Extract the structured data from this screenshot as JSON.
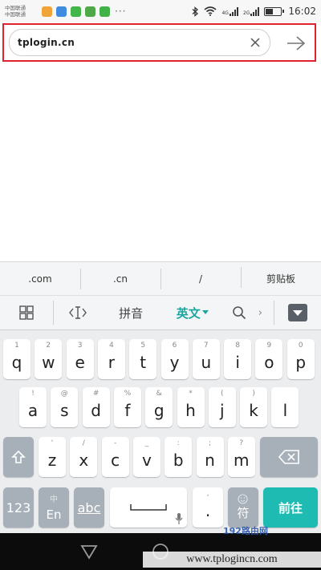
{
  "status_bar": {
    "carrier_lines": [
      "中国联通",
      "中国联通"
    ],
    "app_icon_colors": [
      "#f0a437",
      "#3f8be0",
      "#42b649",
      "#50a948",
      "#41b247"
    ],
    "more_indicator": "···",
    "signal_1": "4G",
    "signal_2": "2G",
    "battery_level": 0.5,
    "time": "16:02"
  },
  "address_bar": {
    "url": "tplogin.cn",
    "clear_icon": "close-icon",
    "go_icon": "arrow-right-icon",
    "highlight_color": "#e0212e"
  },
  "keyboard": {
    "suggestions": [
      ".com",
      ".cn",
      "/",
      "剪贴板"
    ],
    "toolbar": {
      "pinyin_label": "拼音",
      "english_label": "英文",
      "more_chevron": "›"
    },
    "rows": [
      [
        {
          "hint": "1",
          "key": "q"
        },
        {
          "hint": "2",
          "key": "w"
        },
        {
          "hint": "3",
          "key": "e"
        },
        {
          "hint": "4",
          "key": "r"
        },
        {
          "hint": "5",
          "key": "t"
        },
        {
          "hint": "6",
          "key": "y"
        },
        {
          "hint": "7",
          "key": "u"
        },
        {
          "hint": "8",
          "key": "i"
        },
        {
          "hint": "9",
          "key": "o"
        },
        {
          "hint": "0",
          "key": "p"
        }
      ],
      [
        {
          "hint": "!",
          "key": "a"
        },
        {
          "hint": "@",
          "key": "s"
        },
        {
          "hint": "#",
          "key": "d"
        },
        {
          "hint": "%",
          "key": "f"
        },
        {
          "hint": "&",
          "key": "g"
        },
        {
          "hint": "*",
          "key": "h"
        },
        {
          "hint": "(",
          "key": "j"
        },
        {
          "hint": ")",
          "key": "k"
        },
        {
          "hint": "",
          "key": "l"
        }
      ],
      [
        {
          "hint": "'",
          "key": "z"
        },
        {
          "hint": "/",
          "key": "x"
        },
        {
          "hint": "-",
          "key": "c"
        },
        {
          "hint": "_",
          "key": "v"
        },
        {
          "hint": ":",
          "key": "b"
        },
        {
          "hint": ";",
          "key": "n"
        },
        {
          "hint": "?",
          "key": "m"
        }
      ]
    ],
    "bottom": {
      "num_label": "123",
      "lang_top": "中",
      "lang_bottom": "En",
      "abc_label": "abc",
      "comma": ",",
      "period": ".",
      "symbol_label": "符",
      "go_label": "前往"
    },
    "accent_color": "#1ebbb2"
  },
  "watermark": {
    "logo_text": "192路由网",
    "url": "www.tplogincn.com"
  }
}
